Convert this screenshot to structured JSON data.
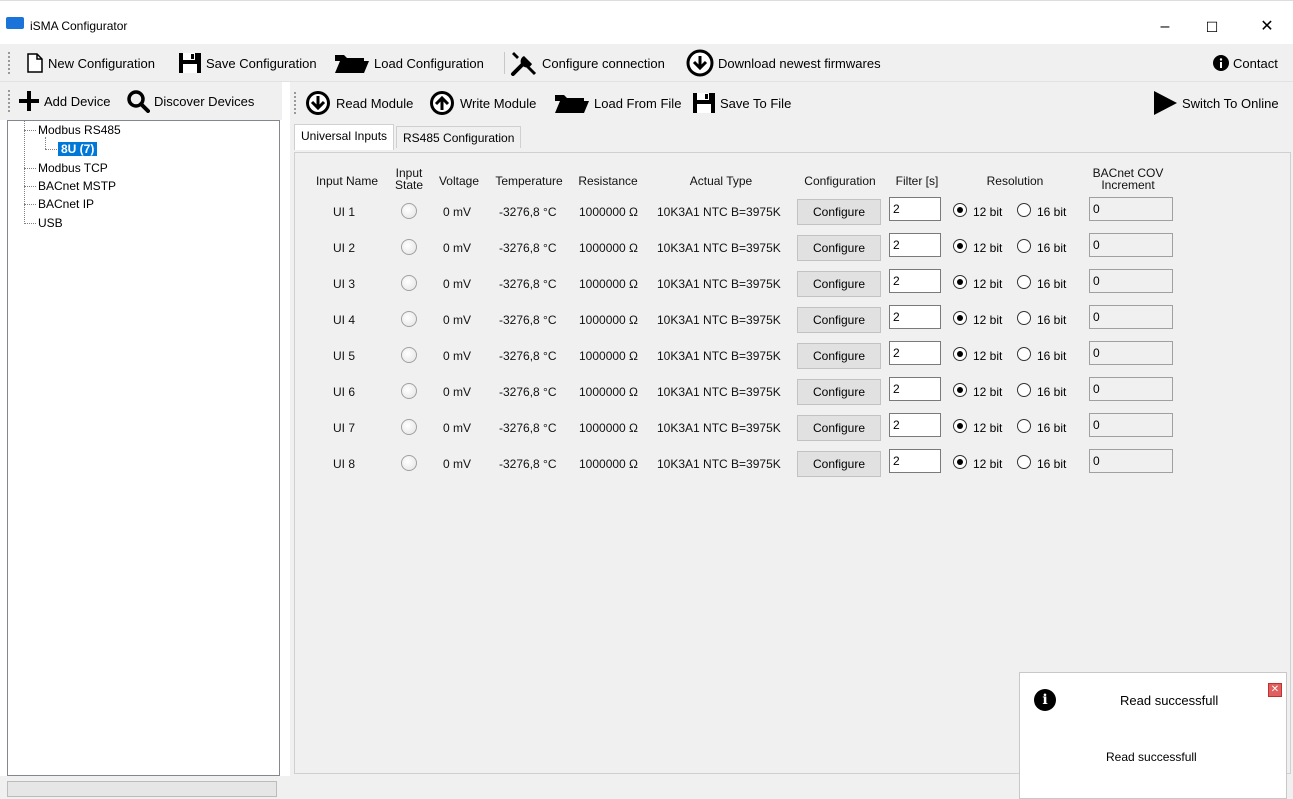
{
  "window": {
    "title": "iSMA Configurator",
    "minimize": "–",
    "maximize": "☐",
    "close": "✕"
  },
  "toolbar": {
    "new_config": "New Configuration",
    "save_config": "Save Configuration",
    "load_config": "Load Configuration",
    "configure_connection": "Configure connection",
    "download_firmwares": "Download newest firmwares",
    "contact": "Contact"
  },
  "left_toolbar": {
    "add_device": "Add Device",
    "discover_devices": "Discover Devices"
  },
  "module_toolbar": {
    "read_module": "Read Module",
    "write_module": "Write Module",
    "load_from_file": "Load From File",
    "save_to_file": "Save To File",
    "switch_online": "Switch To Online"
  },
  "tree": {
    "modbus_rs485": "Modbus RS485",
    "device": "8U (7)",
    "modbus_tcp": "Modbus TCP",
    "bacnet_mstp": "BACnet MSTP",
    "bacnet_ip": "BACnet IP",
    "usb": "USB"
  },
  "tabs": {
    "universal_inputs": "Universal Inputs",
    "rs485_config": "RS485 Configuration"
  },
  "columns": {
    "input_name": "Input Name",
    "input_state_1": "Input",
    "input_state_2": "State",
    "voltage": "Voltage",
    "temperature": "Temperature",
    "resistance": "Resistance",
    "actual_type": "Actual Type",
    "configuration": "Configuration",
    "filter": "Filter [s]",
    "resolution": "Resolution",
    "bacnet_cov_1": "BACnet COV",
    "bacnet_cov_2": "Increment"
  },
  "rows": [
    {
      "name": "UI 1",
      "voltage": "0 mV",
      "temperature": "-3276,8 °C",
      "resistance": "1000000 Ω",
      "type": "10K3A1 NTC B=3975K",
      "configure": "Configure",
      "filter": "2",
      "res12": "12 bit",
      "res16": "16 bit",
      "cov": "0"
    },
    {
      "name": "UI 2",
      "voltage": "0 mV",
      "temperature": "-3276,8 °C",
      "resistance": "1000000 Ω",
      "type": "10K3A1 NTC B=3975K",
      "configure": "Configure",
      "filter": "2",
      "res12": "12 bit",
      "res16": "16 bit",
      "cov": "0"
    },
    {
      "name": "UI 3",
      "voltage": "0 mV",
      "temperature": "-3276,8 °C",
      "resistance": "1000000 Ω",
      "type": "10K3A1 NTC B=3975K",
      "configure": "Configure",
      "filter": "2",
      "res12": "12 bit",
      "res16": "16 bit",
      "cov": "0"
    },
    {
      "name": "UI 4",
      "voltage": "0 mV",
      "temperature": "-3276,8 °C",
      "resistance": "1000000 Ω",
      "type": "10K3A1 NTC B=3975K",
      "configure": "Configure",
      "filter": "2",
      "res12": "12 bit",
      "res16": "16 bit",
      "cov": "0"
    },
    {
      "name": "UI 5",
      "voltage": "0 mV",
      "temperature": "-3276,8 °C",
      "resistance": "1000000 Ω",
      "type": "10K3A1 NTC B=3975K",
      "configure": "Configure",
      "filter": "2",
      "res12": "12 bit",
      "res16": "16 bit",
      "cov": "0"
    },
    {
      "name": "UI 6",
      "voltage": "0 mV",
      "temperature": "-3276,8 °C",
      "resistance": "1000000 Ω",
      "type": "10K3A1 NTC B=3975K",
      "configure": "Configure",
      "filter": "2",
      "res12": "12 bit",
      "res16": "16 bit",
      "cov": "0"
    },
    {
      "name": "UI 7",
      "voltage": "0 mV",
      "temperature": "-3276,8 °C",
      "resistance": "1000000 Ω",
      "type": "10K3A1 NTC B=3975K",
      "configure": "Configure",
      "filter": "2",
      "res12": "12 bit",
      "res16": "16 bit",
      "cov": "0"
    },
    {
      "name": "UI 8",
      "voltage": "0 mV",
      "temperature": "-3276,8 °C",
      "resistance": "1000000 Ω",
      "type": "10K3A1 NTC B=3975K",
      "configure": "Configure",
      "filter": "2",
      "res12": "12 bit",
      "res16": "16 bit",
      "cov": "0"
    }
  ],
  "toast": {
    "title": "Read successfull",
    "message": "Read successfull",
    "info_glyph": "i",
    "close_glyph": "✕"
  },
  "icons": {
    "new": "file-icon",
    "save": "floppy-icon",
    "load": "folder-icon",
    "configure": "wrench-screwdriver-icon",
    "download": "download-circle-icon",
    "contact": "info-icon",
    "add": "plus-icon",
    "discover": "magnifier-icon",
    "read": "arrow-down-circle-icon",
    "write": "arrow-up-circle-icon",
    "switch": "play-icon"
  },
  "colors": {
    "selection": "#0078d7",
    "chrome": "#f0f0f0"
  }
}
